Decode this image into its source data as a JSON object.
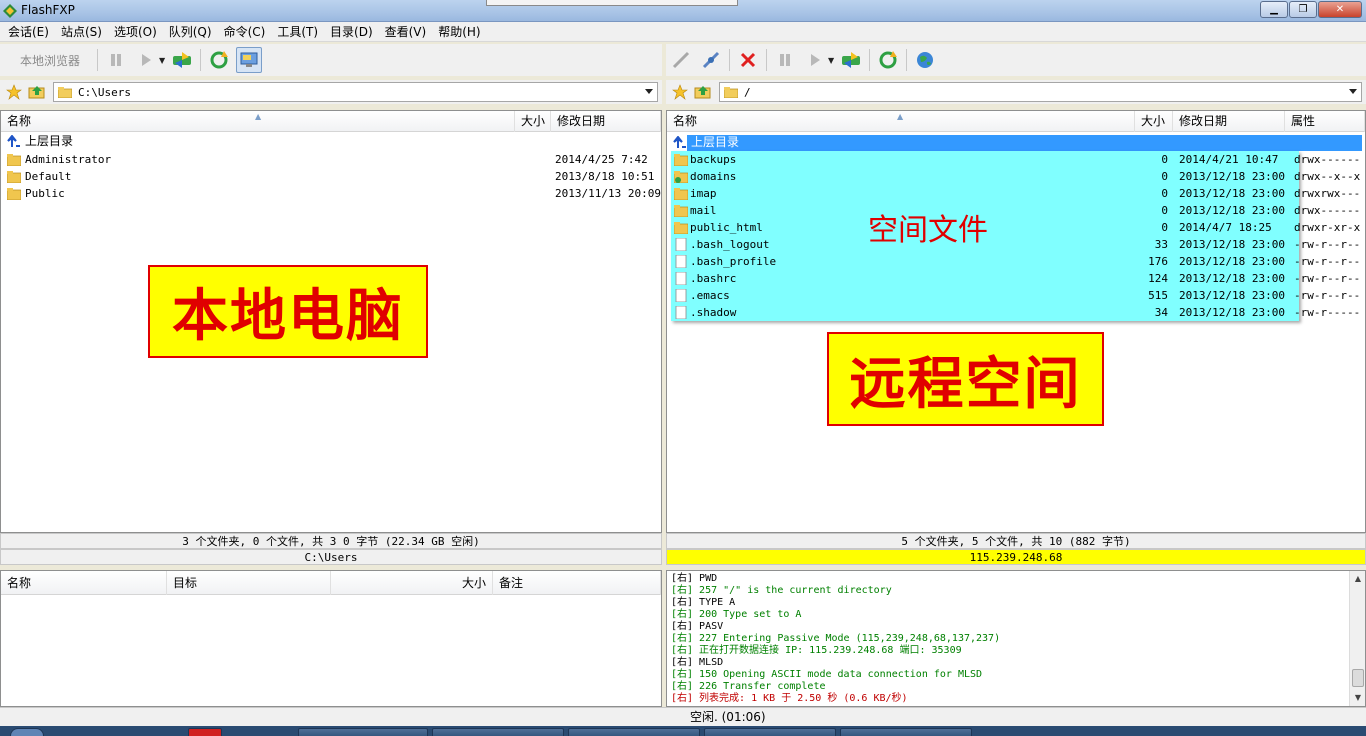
{
  "window": {
    "title": "FlashFXP"
  },
  "menu": [
    "会话(E)",
    "站点(S)",
    "选项(O)",
    "队列(Q)",
    "命令(C)",
    "工具(T)",
    "目录(D)",
    "查看(V)",
    "帮助(H)"
  ],
  "toolbar_left": {
    "local_browser_label": "本地浏览器"
  },
  "local": {
    "path": "C:\\Users",
    "columns": {
      "name": "名称",
      "size": "大小",
      "date": "修改日期"
    },
    "parent_label": "上层目录",
    "rows": [
      {
        "name": "Administrator",
        "date": "2014/4/25 7:42"
      },
      {
        "name": "Default",
        "date": "2013/8/18 10:51"
      },
      {
        "name": "Public",
        "date": "2013/11/13 20:09"
      }
    ],
    "status": "3 个文件夹, 0 个文件, 共 3 0 字节 (22.34 GB 空闲)",
    "status_path": "C:\\Users"
  },
  "remote": {
    "path": "/",
    "columns": {
      "name": "名称",
      "size": "大小",
      "date": "修改日期",
      "attr": "属性"
    },
    "parent_label": "上层目录",
    "rows": [
      {
        "name": "backups",
        "size": "0",
        "date": "2014/4/21 10:47",
        "attr": "drwx------",
        "type": "folder"
      },
      {
        "name": "domains",
        "size": "0",
        "date": "2013/12/18 23:00",
        "attr": "drwx--x--x",
        "type": "folder-link"
      },
      {
        "name": "imap",
        "size": "0",
        "date": "2013/12/18 23:00",
        "attr": "drwxrwx---",
        "type": "folder"
      },
      {
        "name": "mail",
        "size": "0",
        "date": "2013/12/18 23:00",
        "attr": "drwx------",
        "type": "folder"
      },
      {
        "name": "public_html",
        "size": "0",
        "date": "2014/4/7 18:25",
        "attr": "drwxr-xr-x",
        "type": "folder"
      },
      {
        "name": ".bash_logout",
        "size": "33",
        "date": "2013/12/18 23:00",
        "attr": "-rw-r--r--",
        "type": "file"
      },
      {
        "name": ".bash_profile",
        "size": "176",
        "date": "2013/12/18 23:00",
        "attr": "-rw-r--r--",
        "type": "file"
      },
      {
        "name": ".bashrc",
        "size": "124",
        "date": "2013/12/18 23:00",
        "attr": "-rw-r--r--",
        "type": "file"
      },
      {
        "name": ".emacs",
        "size": "515",
        "date": "2013/12/18 23:00",
        "attr": "-rw-r--r--",
        "type": "file"
      },
      {
        "name": ".shadow",
        "size": "34",
        "date": "2013/12/18 23:00",
        "attr": "-rw-r-----",
        "type": "file"
      }
    ],
    "status": "5 个文件夹, 5 个文件, 共 10 (882 字节)",
    "server_ip": "115.239.248.68"
  },
  "annotations": {
    "local": "本地电脑",
    "remote": "远程空间",
    "space_files": "空间文件"
  },
  "queue": {
    "columns": {
      "name": "名称",
      "target": "目标",
      "size": "大小",
      "note": "备注"
    }
  },
  "log": [
    {
      "text": "[右] PWD",
      "color": "#000000"
    },
    {
      "text": "[右] 257 \"/\" is the current directory",
      "color": "#008000"
    },
    {
      "text": "[右] TYPE A",
      "color": "#000000"
    },
    {
      "text": "[右] 200 Type set to A",
      "color": "#008000"
    },
    {
      "text": "[右] PASV",
      "color": "#000000"
    },
    {
      "text": "[右] 227 Entering Passive Mode (115,239,248,68,137,237)",
      "color": "#008000"
    },
    {
      "text": "[右] 正在打开数据连接 IP: 115.239.248.68 端口: 35309",
      "color": "#008000"
    },
    {
      "text": "[右] MLSD",
      "color": "#000000"
    },
    {
      "text": "[右] 150 Opening ASCII mode data connection for MLSD",
      "color": "#008000"
    },
    {
      "text": "[右] 226 Transfer complete",
      "color": "#008000"
    },
    {
      "text": "[右] 列表完成: 1 KB 于 2.50 秒 (0.6 KB/秒)",
      "color": "#c00000"
    }
  ],
  "status_bottom": "空闲. (01:06)",
  "colors": {
    "selection": "#3399ff",
    "highlight_cyan": "#80ffff",
    "ip_bar": "#ffff00",
    "annot_red": "#e00000",
    "annot_yellow": "#ffff00"
  }
}
